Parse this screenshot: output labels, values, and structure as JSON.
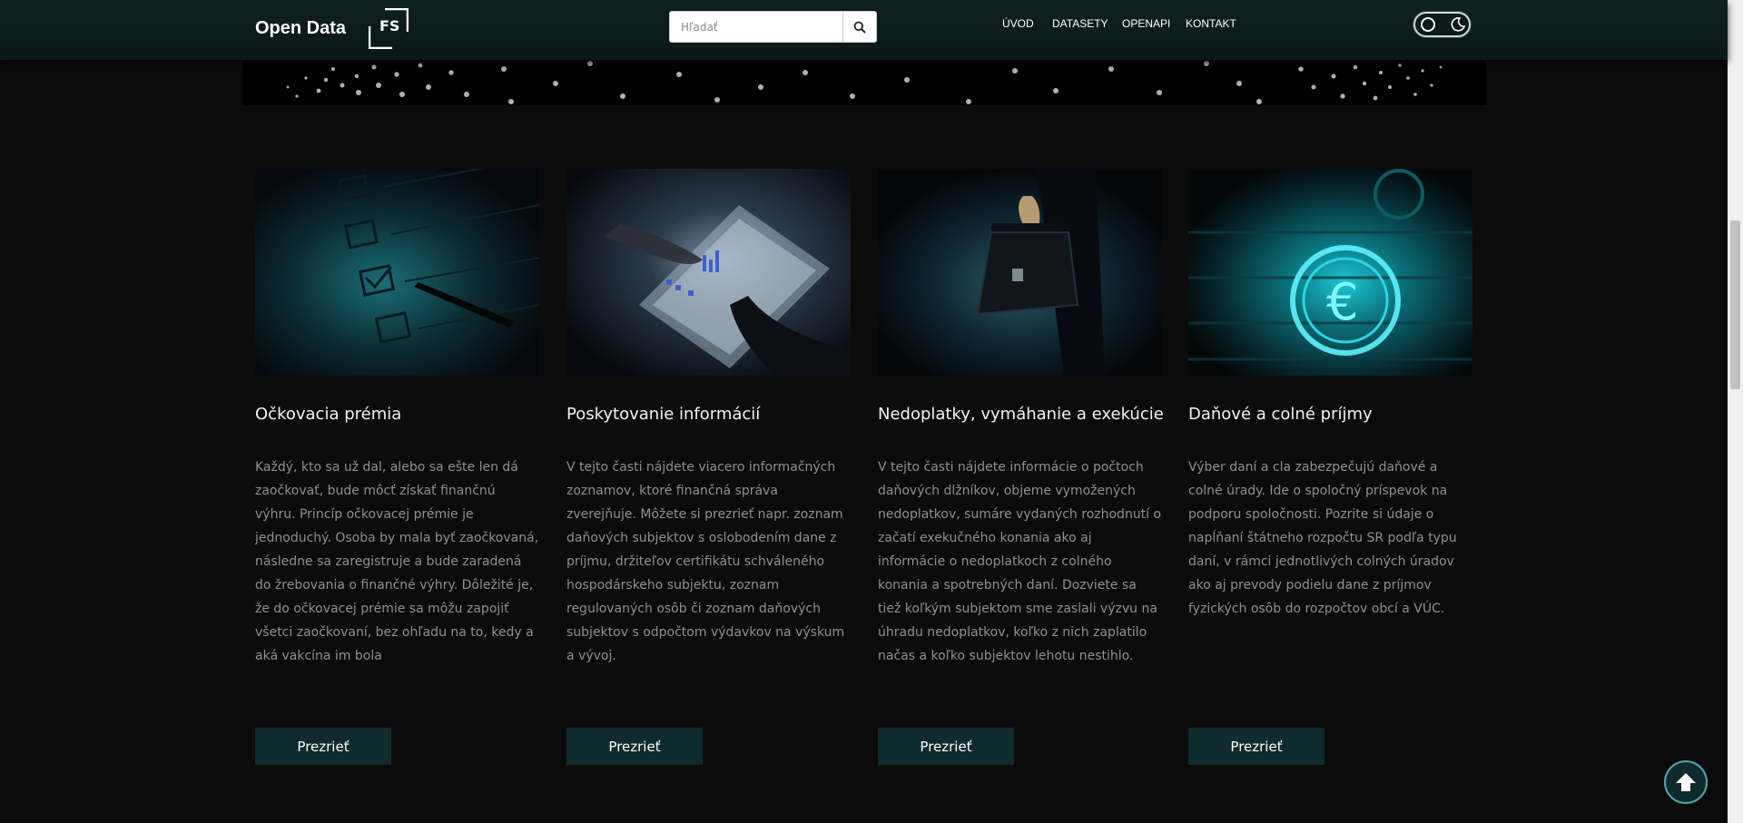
{
  "header": {
    "brand": "Open Data",
    "logo_text": "FS",
    "search_placeholder": "Hľadať",
    "nav": [
      "ÚVOD",
      "DATASETY",
      "OPENAPI",
      "KONTAKT"
    ]
  },
  "cards": [
    {
      "title": "Očkovacia prémia",
      "text": "Každý, kto sa už dal, alebo sa ešte len dá zaočkovať, bude môcť získať finančnú výhru. Princíp očkovacej prémie je jednoduchý. Osoba by mala byť zaočkovaná, následne sa zaregistruje a bude zaradená do žrebovania o finančné výhry. Dôležité je, že do očkovacej prémie sa môžu zapojiť všetci zaočkovaní, bez ohľadu na to, kedy a aká vakcína im bola",
      "button": "Prezrieť"
    },
    {
      "title": "Poskytovanie informácií",
      "text": "V tejto časti nájdete viacero informačných zoznamov, ktoré finančná správa zverejňuje. Môžete si prezrieť napr. zoznam daňových subjektov s oslobodením dane z príjmu, držiteľov certifikátu schváleného hospodárskeho subjektu, zoznam regulovaných osôb či zoznam daňových subjektov s odpočtom výdavkov na výskum a vývoj.",
      "button": "Prezrieť"
    },
    {
      "title": "Nedoplatky, vymáhanie a exekúcie",
      "text": "V tejto časti nájdete informácie o počtoch daňových dlžníkov, objeme vymožených nedoplatkov, sumáre vydaných rozhodnutí o začatí exekučného konania ako aj informácie o nedoplatkoch  z colného konania a spotrebných daní. Dozviete sa tiež koľkým subjektom sme zaslali výzvu na úhradu nedoplatkov, koľko z nich zaplatilo načas a koľko subjektov lehotu nestihlo.",
      "button": "Prezrieť"
    },
    {
      "title": "Daňové a colné príjmy",
      "text": "Výber daní a cla zabezpečujú daňové a colné úrady. Ide o spoločný príspevok na podporu spoločnosti. Pozrite si údaje o napĺňaní štátneho rozpočtu SR podľa typu daní, v rámci jednotlivých colných úradov ako aj prevody podielu dane z príjmov fyzických osôb do rozpočtov obcí a VÚC.",
      "button": "Prezrieť"
    }
  ],
  "colors": {
    "accent": "#0f2b2d",
    "background": "#0b0b0b",
    "header": "#0e2022",
    "teal_glow": "#19c6d6"
  }
}
